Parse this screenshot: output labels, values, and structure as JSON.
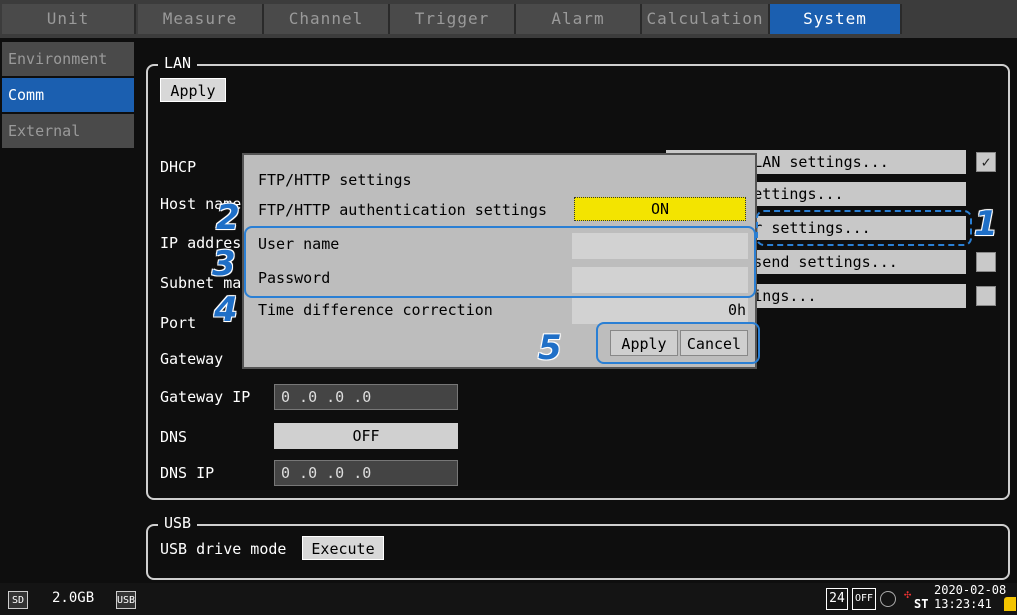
{
  "tabs": [
    "Unit",
    "Measure",
    "Channel",
    "Trigger",
    "Alarm",
    "Calculation",
    "System"
  ],
  "active_tab": "System",
  "sidebar": [
    "Environment",
    "Comm",
    "External"
  ],
  "lan": {
    "group_label": "LAN",
    "apply_label": "Apply",
    "dhcp_label": "DHCP",
    "host_label": "Host name",
    "ip_label": "IP address",
    "subnet_label": "Subnet mask",
    "port_label": "Port",
    "gateway_label": "Gateway",
    "gateway_ip_label": "Gateway IP",
    "gateway_ip_value": "0 .0 .0 .0",
    "dns_label": "DNS",
    "dns_value": "OFF",
    "dns_ip_label": "DNS IP",
    "dns_ip_value": "0 .0 .0 .0",
    "right_buttons": [
      "Wireless LAN settings...",
      "Command settings...",
      "FTP server settings...",
      "FTP auto send settings...",
      "SNTP settings..."
    ]
  },
  "usb": {
    "group_label": "USB",
    "drive_mode_label": "USB drive mode",
    "execute_label": "Execute"
  },
  "dialog": {
    "title": "FTP/HTTP settings",
    "auth_label": "FTP/HTTP authentication settings",
    "auth_value": "ON",
    "user_label": "User name",
    "password_label": "Password",
    "time_diff_label": "Time difference correction",
    "time_diff_value": "0h",
    "apply_label": "Apply",
    "cancel_label": "Cancel"
  },
  "callouts": [
    "1",
    "2",
    "3",
    "4",
    "5"
  ],
  "status": {
    "storage": "2.0GB",
    "count": "24",
    "off": "OFF",
    "date": "2020-02-08",
    "time": "13:23:41",
    "st": "ST"
  },
  "colors": {
    "accent": "#1b5fb0",
    "highlight": "#f3e400",
    "callout": "#1f6fc7"
  }
}
